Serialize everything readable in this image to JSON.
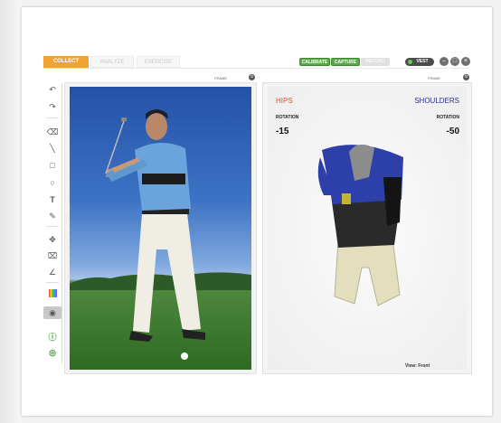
{
  "tabs": [
    {
      "label": "COLLECT",
      "active": true
    },
    {
      "label": "ANALYZE",
      "active": false
    },
    {
      "label": "EXERCISE",
      "active": false
    }
  ],
  "header_buttons": {
    "calibrate": "CALIBRATE",
    "capture": "CAPTURE",
    "record": "RECORD",
    "vest": "VEST"
  },
  "window_controls": [
    "minimize-icon",
    "maximize-icon",
    "close-icon"
  ],
  "video_panel": {
    "frame_label": "FRAME"
  },
  "model_panel": {
    "frame_label": "FRAME",
    "left": {
      "title": "HIPS",
      "sub": "ROTATION",
      "value": "-15"
    },
    "right": {
      "title": "SHOULDERS",
      "sub": "ROTATION",
      "value": "-50"
    },
    "view_label": "View: Front"
  },
  "tools": [
    "undo-icon",
    "redo-icon",
    "eraser-icon",
    "line-icon",
    "rectangle-icon",
    "circle-icon",
    "text-icon",
    "pen-icon",
    "pan-icon",
    "trash-icon",
    "angle-icon",
    "color-icon",
    "eye-icon",
    "sync-icon",
    "orbit-icon"
  ],
  "colors": {
    "accent": "#f2a134",
    "green": "#5aa84a",
    "hips": "#e44f2e",
    "shoulders": "#2d2f8a"
  }
}
